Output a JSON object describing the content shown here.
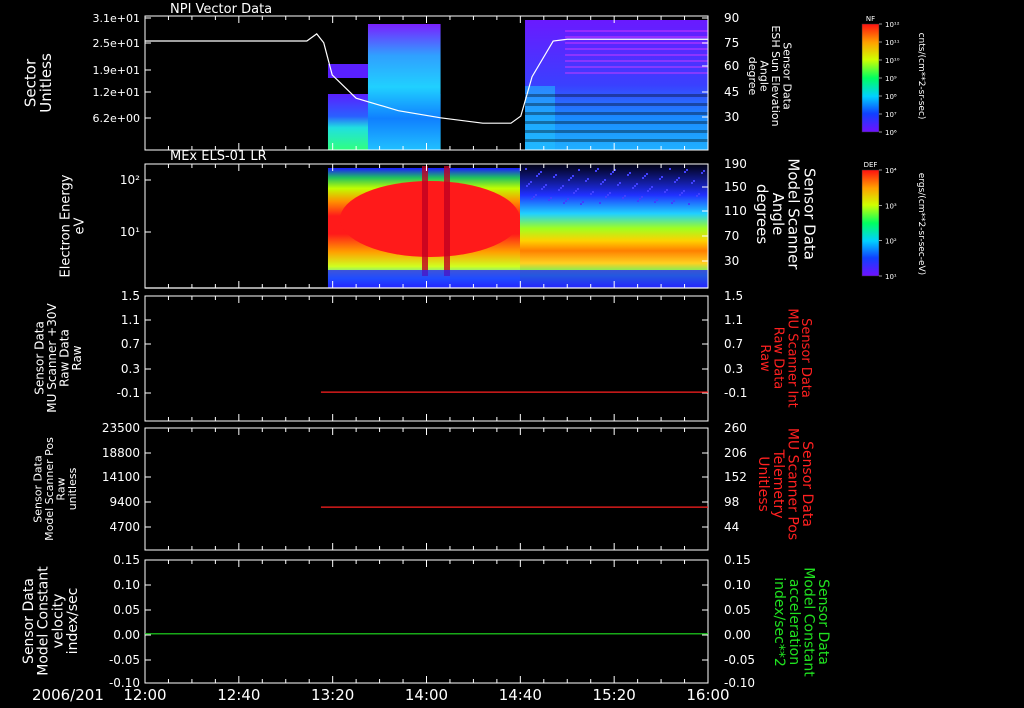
{
  "date_label": "2006/201",
  "time_ticks": [
    "12:00",
    "12:40",
    "13:20",
    "14:00",
    "14:40",
    "15:20",
    "16:00"
  ],
  "colors": {
    "background": "#000000",
    "axis": "#ffffff",
    "red_trace": "#ff2020",
    "green_trace": "#20e020",
    "white_trace": "#ffffff"
  },
  "chart_data": [
    {
      "type": "heatmap",
      "title": "NPI Vector Data",
      "ylabel_lines": [
        "Sector",
        "Unitless"
      ],
      "y_ticks": [
        "3.1e+01",
        "2.5e+01",
        "1.9e+01",
        "1.2e+01",
        "6.2e+00"
      ],
      "right_ylabel_lines": [
        "Sensor Data",
        "ESH Sun Elevation",
        "Angle",
        "degree"
      ],
      "right_ticks": [
        "90",
        "75",
        "60",
        "45",
        "30"
      ],
      "right_ylim": [
        15,
        90
      ],
      "xlim_hours": [
        12.0,
        16.0
      ],
      "data_gap_hours": [
        14.1,
        14.7
      ],
      "data_start_hours": 13.3,
      "series": [
        {
          "x_hours": [
            12.0,
            13.15,
            13.22,
            13.27,
            13.33,
            13.5,
            13.8,
            14.1,
            14.4,
            14.6,
            14.67,
            14.75,
            14.9,
            15.0,
            16.0
          ],
          "values": [
            76,
            76,
            80,
            75,
            57,
            44,
            37,
            33,
            30,
            30,
            34,
            56,
            76,
            77,
            77
          ]
        }
      ],
      "colorbar": {
        "label": "NF",
        "units": "cnts/(cm**2-sr-sec)",
        "ticks": [
          "10¹²",
          "10¹¹",
          "10¹⁰",
          "10⁹",
          "10⁸",
          "10⁷",
          "10⁶"
        ]
      }
    },
    {
      "type": "heatmap",
      "title": "MEx ELS-01 LR",
      "ylabel_lines": [
        "Electron Energy",
        "eV"
      ],
      "y_ticks": [
        "10²",
        "10¹"
      ],
      "right_ylabel_lines": [
        "Sensor Data",
        "Model Scanner",
        "Angle",
        "degrees"
      ],
      "right_ticks": [
        "190",
        "150",
        "110",
        "70",
        "30"
      ],
      "right_ylim": [
        10,
        190
      ],
      "xlim_hours": [
        12.0,
        16.0
      ],
      "data_start_hours": 13.3,
      "series": [
        {
          "x_hours": [
            12.0,
            16.0
          ],
          "values": [
            10,
            10
          ]
        }
      ],
      "colorbar": {
        "label": "DEF",
        "units": "ergs/(cm**2-sr-sec-eV)",
        "ticks": [
          "10⁴",
          "10³",
          "10²",
          "10¹"
        ]
      }
    },
    {
      "type": "line",
      "ylabel_lines": [
        "Sensor Data",
        "MU Scanner +30V",
        "Raw Data",
        "Raw"
      ],
      "y_ticks": [
        "1.5",
        "1.1",
        "0.7",
        "0.3",
        "-0.1"
      ],
      "right_ylabel_lines": [
        "Sensor Data",
        "MU Scanner Int",
        "Raw Data",
        "Raw"
      ],
      "right_ticks": [
        "1.5",
        "1.1",
        "0.7",
        "0.3",
        "-0.1"
      ],
      "ylim": [
        -0.45,
        1.5
      ],
      "xlim_hours": [
        12.0,
        16.0
      ],
      "series": [
        {
          "color": "red",
          "x_hours": [
            13.25,
            16.0
          ],
          "values": [
            0.0,
            0.0
          ]
        }
      ]
    },
    {
      "type": "line",
      "ylabel_lines": [
        "Sensor Data",
        "Model Scanner Pos",
        "Raw",
        "unitless"
      ],
      "y_ticks": [
        "23500",
        "18800",
        "14100",
        "9400",
        "4700"
      ],
      "right_ylabel_lines": [
        "Sensor Data",
        "MU Scanner Pos",
        "Telemetry",
        "Unitless"
      ],
      "right_ticks": [
        "260",
        "206",
        "152",
        "98",
        "44"
      ],
      "ylim": [
        -250,
        23500
      ],
      "right_ylim": [
        -10,
        260
      ],
      "xlim_hours": [
        12.0,
        16.0
      ],
      "series": [
        {
          "color": "red",
          "x_hours": [
            13.25,
            16.0
          ],
          "values": [
            8100,
            8100
          ]
        }
      ]
    },
    {
      "type": "line",
      "ylabel_lines": [
        "Sensor Data",
        "Model Constant",
        "velocity",
        "index/sec"
      ],
      "y_ticks": [
        "0.15",
        "0.10",
        "0.05",
        "0.00",
        "-0.05",
        "-0.10"
      ],
      "right_ylabel_lines": [
        "Sensor Data",
        "Model Constant",
        "acceleration",
        "index/sec**2"
      ],
      "right_ticks": [
        "0.15",
        "0.10",
        "0.05",
        "0.00",
        "-0.05",
        "-0.10"
      ],
      "ylim": [
        -0.1,
        0.15
      ],
      "xlim_hours": [
        12.0,
        16.0
      ],
      "series": [
        {
          "color": "green",
          "x_hours": [
            12.0,
            16.0
          ],
          "values": [
            0.0,
            0.0
          ]
        }
      ]
    }
  ]
}
